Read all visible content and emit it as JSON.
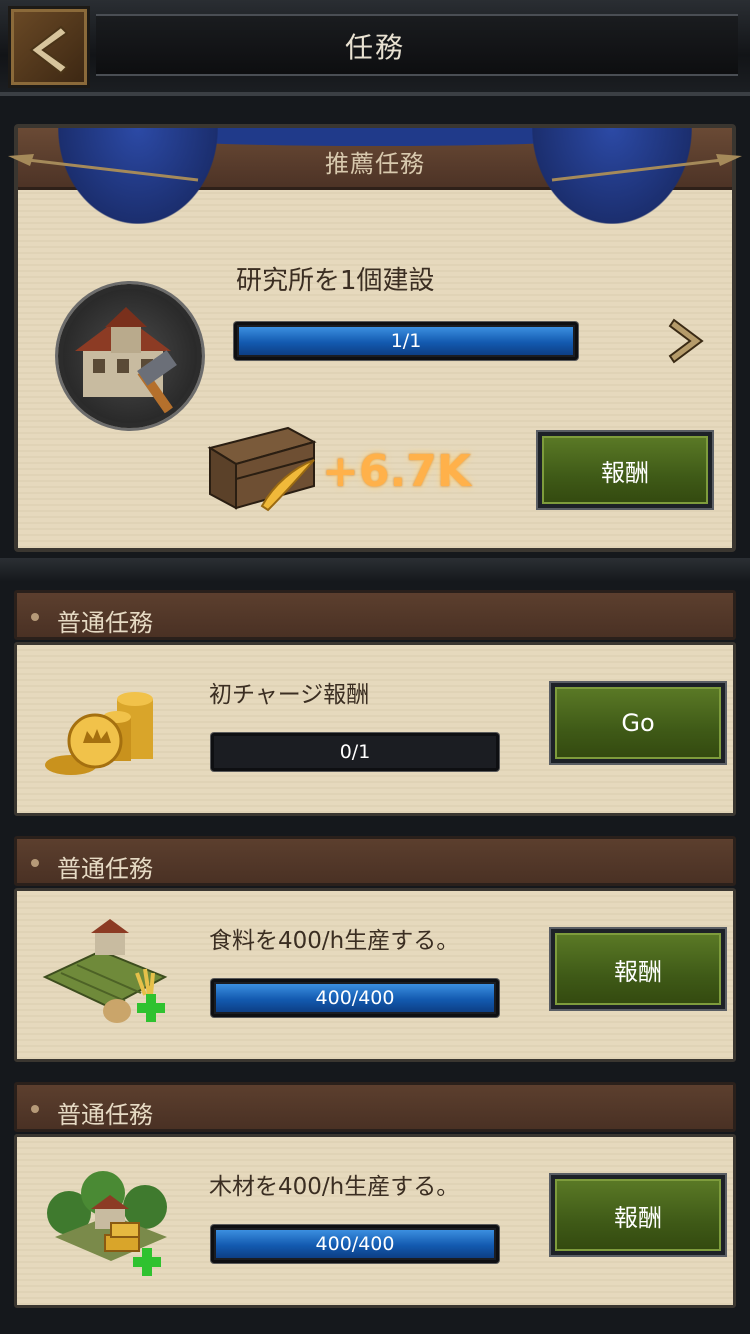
{
  "header": {
    "title": "任務",
    "back_icon": "back-arrow-icon"
  },
  "featured": {
    "heading": "推薦任務",
    "description": "研究所を1個建設",
    "progress_text": "1/1",
    "progress": 1.0,
    "reward_amount": "+6.7K",
    "button_label": "報酬"
  },
  "quests": [
    {
      "header": "普通任務",
      "description": "初チャージ報酬",
      "progress_text": "0/1",
      "progress": 0.0,
      "button_label": "Go",
      "icon": "gold-coins-icon"
    },
    {
      "header": "普通任務",
      "description": "食料を400/h生産する。",
      "progress_text": "400/400",
      "progress": 1.0,
      "button_label": "報酬",
      "icon": "farm-icon"
    },
    {
      "header": "普通任務",
      "description": "木材を400/h生産する。",
      "progress_text": "400/400",
      "progress": 1.0,
      "button_label": "報酬",
      "icon": "lumber-mill-icon"
    }
  ],
  "colors": {
    "progress_blue": "#135ab0",
    "button_green": "#3f5a17",
    "reward_orange": "#ffb14a",
    "parchment": "#e6d9bd"
  }
}
